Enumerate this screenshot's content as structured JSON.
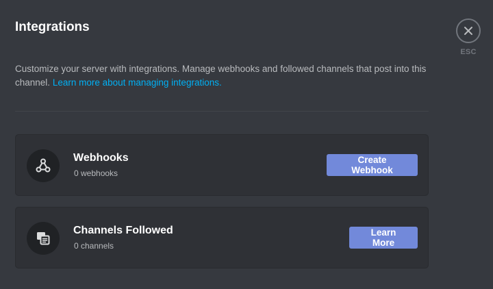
{
  "header": {
    "title": "Integrations"
  },
  "close": {
    "label": "ESC"
  },
  "intro": {
    "text": "Customize your server with integrations. Manage webhooks and followed channels that post into this channel.",
    "link_text": "Learn more about managing integrations."
  },
  "cards": [
    {
      "title": "Webhooks",
      "subtitle": "0 webhooks",
      "button_label": "Create Webhook",
      "icon": "webhook-icon"
    },
    {
      "title": "Channels Followed",
      "subtitle": "0 channels",
      "button_label": "Learn More",
      "icon": "channel-follow-icon"
    }
  ],
  "colors": {
    "background": "#36393f",
    "card": "#2f3136",
    "accent": "#7289da",
    "link": "#00b0f4"
  }
}
